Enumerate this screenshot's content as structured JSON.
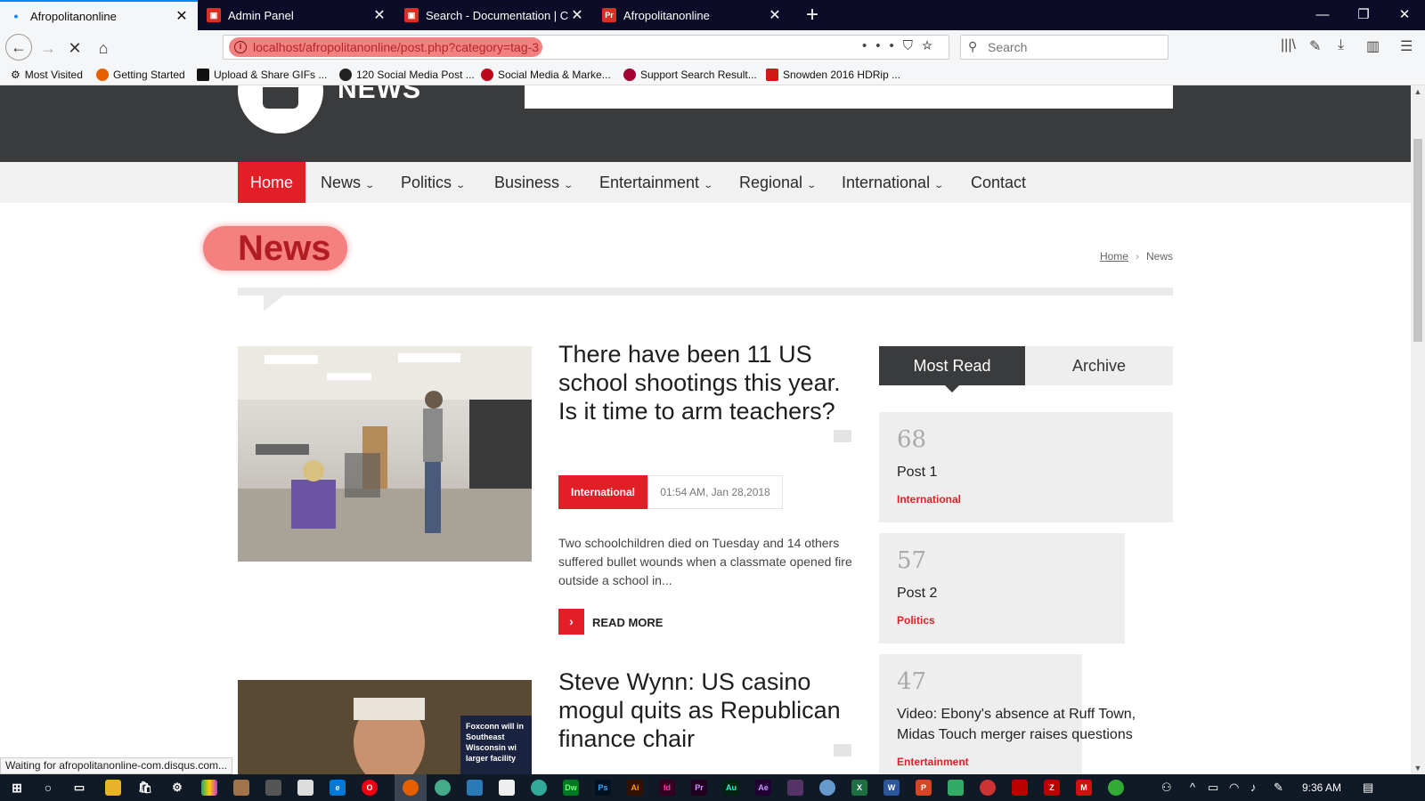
{
  "browser": {
    "tabs": [
      {
        "label": "Afropolitanonline",
        "favicon_color": "#0a84ff"
      },
      {
        "label": "Admin Panel",
        "favicon_color": "#d93025"
      },
      {
        "label": "Search - Documentation | Couc",
        "favicon_color": "#d93025"
      },
      {
        "label": "Afropolitanonline",
        "favicon_color": "#d93025",
        "favicon_text": "Pr"
      }
    ],
    "url": "localhost/afropolitanonline/post.php?category=tag-3",
    "search_placeholder": "Search",
    "bookmarks": [
      "Most Visited",
      "Getting Started",
      "Upload & Share GIFs ...",
      "120 Social Media Post ...",
      "Social Media & Marke...",
      "Support Search Result...",
      "Snowden 2016 HDRip ..."
    ],
    "status": "Waiting for afropolitanonline-com.disqus.com..."
  },
  "site": {
    "logo_text": "NEWS",
    "nav": [
      {
        "label": "Home",
        "dropdown": false,
        "active": true
      },
      {
        "label": "News",
        "dropdown": true
      },
      {
        "label": "Politics",
        "dropdown": true
      },
      {
        "label": "Business",
        "dropdown": true
      },
      {
        "label": "Entertainment",
        "dropdown": true
      },
      {
        "label": "Regional",
        "dropdown": true
      },
      {
        "label": "International",
        "dropdown": true
      },
      {
        "label": "Contact",
        "dropdown": false
      }
    ],
    "page_title": "News",
    "breadcrumb": {
      "home": "Home",
      "current": "News"
    }
  },
  "posts": [
    {
      "title": "There have been 11 US school shootings this year. Is it time to arm teachers?",
      "category": "International",
      "date": "01:54 AM, Jan 28,2018",
      "excerpt": "Two schoolchildren died on Tuesday and 14 others suffered bullet wounds when a classmate opened fire outside a school in...",
      "read_more": "READ MORE"
    },
    {
      "title": "Steve Wynn: US casino mogul quits as Republican finance chair",
      "image_caption": "Foxconn will in Southeast Wisconsin wi larger facility"
    }
  ],
  "sidebar": {
    "tabs": [
      "Most Read",
      "Archive"
    ],
    "most_read": [
      {
        "count": "68",
        "title": "Post 1",
        "category": "International"
      },
      {
        "count": "57",
        "title": "Post 2",
        "category": "Politics"
      },
      {
        "count": "47",
        "title": "Video: Ebony's absence at Ruff Town, Midas Touch merger raises questions",
        "category": "Entertainment"
      }
    ]
  },
  "taskbar": {
    "time": "9:36 AM"
  }
}
